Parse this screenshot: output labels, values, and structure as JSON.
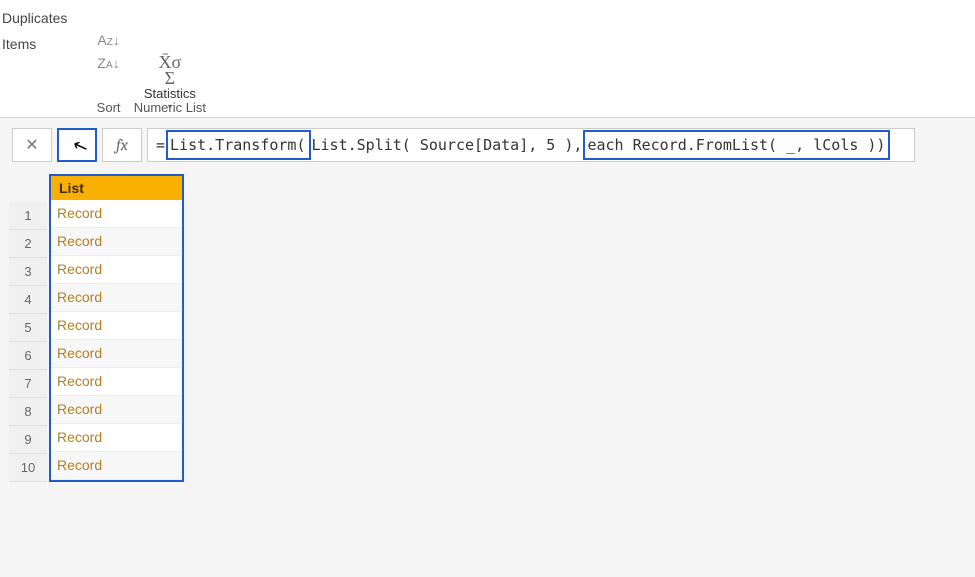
{
  "ribbon": {
    "leftItems": [
      "Duplicates",
      "Items"
    ],
    "sort": {
      "label": "Sort",
      "ascIcon": "A→Z↓",
      "descIcon": "Z→A↓"
    },
    "numericList": {
      "label": "Numeric List",
      "statsLabel": "Statistics",
      "statsGlyphTop": "X̄σ",
      "statsGlyphBottom": "Σ"
    }
  },
  "formulaBar": {
    "cancelIcon": "✕",
    "confirmIcon": "✓",
    "fxLabel": "fx",
    "segments": {
      "equals": "= ",
      "p1": "List.Transform( ",
      "mid": "List.Split( Source[Data], 5 ),",
      "space": " ",
      "p2": "each Record.FromList( _, lCols ))"
    }
  },
  "resultList": {
    "header": "List",
    "rows": [
      {
        "index": 1,
        "value": "Record"
      },
      {
        "index": 2,
        "value": "Record"
      },
      {
        "index": 3,
        "value": "Record"
      },
      {
        "index": 4,
        "value": "Record"
      },
      {
        "index": 5,
        "value": "Record"
      },
      {
        "index": 6,
        "value": "Record"
      },
      {
        "index": 7,
        "value": "Record"
      },
      {
        "index": 8,
        "value": "Record"
      },
      {
        "index": 9,
        "value": "Record"
      },
      {
        "index": 10,
        "value": "Record"
      }
    ]
  }
}
